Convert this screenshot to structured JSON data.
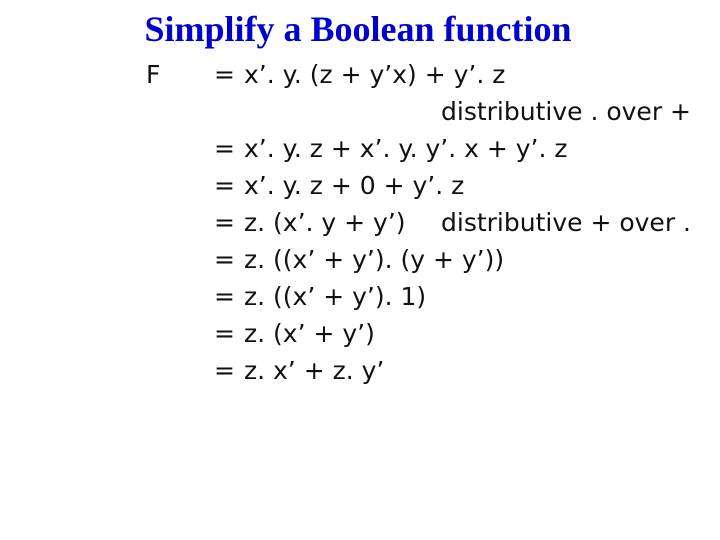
{
  "slide": {
    "title": "Simplify a Boolean function",
    "title_color": "#0000d0",
    "lhs": "F",
    "steps": [
      {
        "eq": "=",
        "expr": "x’. y. (z + y’x) + y’. z",
        "note": ""
      },
      {
        "eq": "",
        "expr": "",
        "note": "distributive . over +"
      },
      {
        "eq": "=",
        "expr": "x’. y. z + x’. y. y’. x + y’. z",
        "note": ""
      },
      {
        "eq": "=",
        "expr": "x’. y. z + 0 + y’. z",
        "note": ""
      },
      {
        "eq": "=",
        "expr": "z. (x’. y + y’)",
        "note": "distributive + over ."
      },
      {
        "eq": "=",
        "expr": "z. ((x’ + y’). (y + y’))",
        "note": ""
      },
      {
        "eq": "=",
        "expr": "z. ((x’ + y’). 1)",
        "note": ""
      },
      {
        "eq": "=",
        "expr": "z. (x’ + y’)",
        "note": ""
      },
      {
        "eq": "=",
        "expr": "z. x’ + z. y’",
        "note": ""
      }
    ]
  }
}
